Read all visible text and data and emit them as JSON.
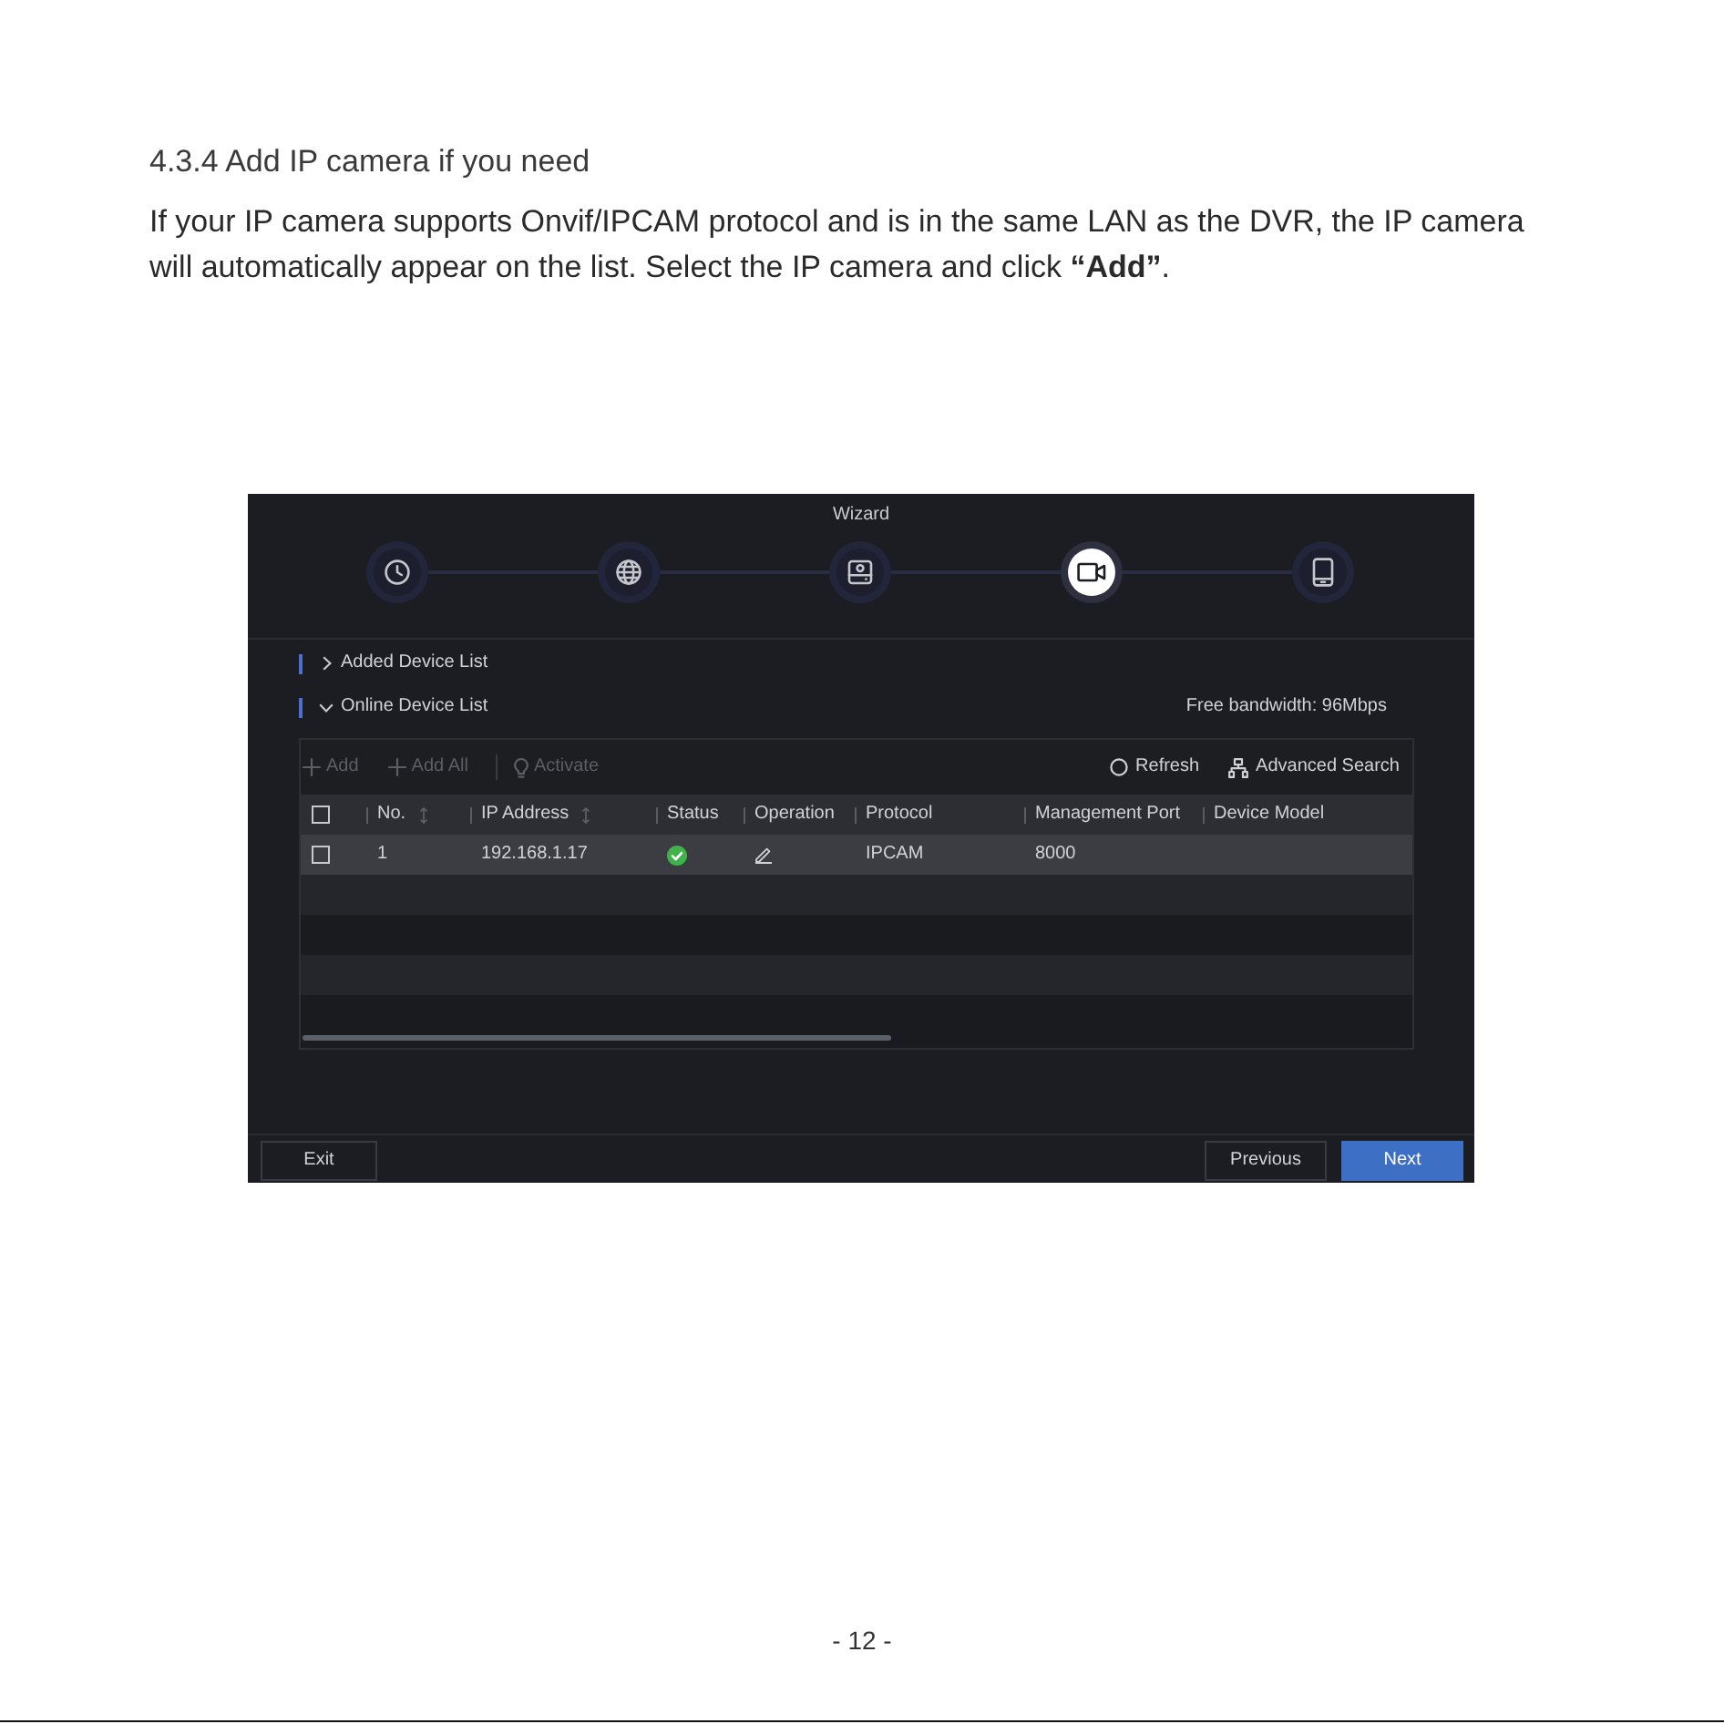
{
  "section": {
    "heading": "4.3.4 Add IP camera if you need",
    "paragraph": "If your IP camera supports Onvif/IPCAM protocol and is in the same LAN as the DVR, the IP camera will automatically appear on the list. Select the IP camera and click **“Add”**."
  },
  "wizard": {
    "title": "Wizard",
    "steps": [
      {
        "kind": "time",
        "selected": false
      },
      {
        "kind": "network",
        "selected": false
      },
      {
        "kind": "disk",
        "selected": false
      },
      {
        "kind": "camera",
        "selected": true
      },
      {
        "kind": "device",
        "selected": false
      }
    ]
  },
  "device_lists": [
    {
      "label": "Added Device List",
      "expanded": false
    },
    {
      "label": "Online Device List",
      "expanded": true
    }
  ],
  "free_bandwidth": "Free bandwidth: 96Mbps",
  "toolbar": {
    "left": [
      {
        "kind": "add",
        "label": "Add",
        "disabled": true
      },
      {
        "kind": "add",
        "label": "Add All",
        "disabled": true
      },
      {
        "kind": "activate",
        "label": "Activate",
        "disabled": true
      }
    ],
    "right": [
      {
        "kind": "refresh",
        "label": "Refresh",
        "disabled": false
      },
      {
        "kind": "search",
        "label": "Advanced Search",
        "disabled": false
      }
    ]
  },
  "table": {
    "header_checked": false,
    "columns": [
      {
        "label": "No.",
        "sortable": true
      },
      {
        "label": "IP Address",
        "sortable": true
      },
      {
        "label": "Status",
        "sortable": false
      },
      {
        "label": "Operation",
        "sortable": false
      },
      {
        "label": "Protocol",
        "sortable": false
      },
      {
        "label": "Management Port",
        "sortable": false
      },
      {
        "label": "Device Model",
        "sortable": false
      }
    ],
    "rows": [
      {
        "checked": false,
        "selected": true,
        "cells": [
          {
            "kind": "text",
            "text": "1"
          },
          {
            "kind": "text",
            "text": "192.168.1.17"
          },
          {
            "kind": "status",
            "online": true
          },
          {
            "kind": "edit"
          },
          {
            "kind": "text",
            "text": "IPCAM"
          },
          {
            "kind": "text",
            "text": "8000"
          }
        ]
      }
    ]
  },
  "buttons": {
    "left": [
      {
        "label": "Exit",
        "primary": false
      }
    ],
    "right": [
      {
        "label": "Previous",
        "primary": false
      },
      {
        "label": "Next",
        "primary": true
      }
    ]
  },
  "page_number": "- 12 -"
}
